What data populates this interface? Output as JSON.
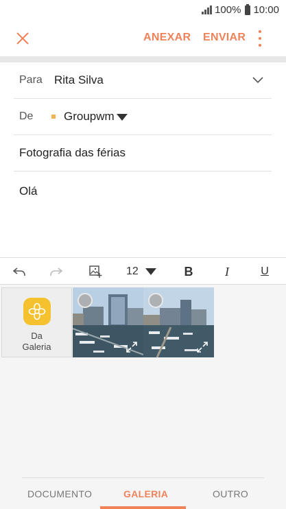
{
  "status_bar": {
    "battery": "100%",
    "time": "10:00"
  },
  "action_bar": {
    "attach_label": "ANEXAR",
    "send_label": "ENVIAR"
  },
  "compose": {
    "to_label": "Para",
    "to_value": "Rita Silva",
    "from_label": "De",
    "from_value": "Groupwm",
    "subject": "Fotografia das férias",
    "body": "Olá"
  },
  "toolbar": {
    "font_size": "12",
    "bold": "B",
    "italic": "I",
    "underline": "U"
  },
  "gallery_tile": {
    "line1": "Da",
    "line2": "Galeria"
  },
  "tabs": [
    {
      "label": "DOCUMENTO",
      "selected": false
    },
    {
      "label": "GALERIA",
      "selected": true
    },
    {
      "label": "OUTRO",
      "selected": false
    }
  ],
  "colors": {
    "accent": "#f0825a",
    "gallery_icon": "#f5c12e",
    "panel_bg": "#f5f5f5"
  },
  "icons": [
    "close-icon",
    "more-icon",
    "chevron-down-icon",
    "undo-icon",
    "redo-icon",
    "insert-image-icon",
    "gallery-icon",
    "expand-icon"
  ]
}
